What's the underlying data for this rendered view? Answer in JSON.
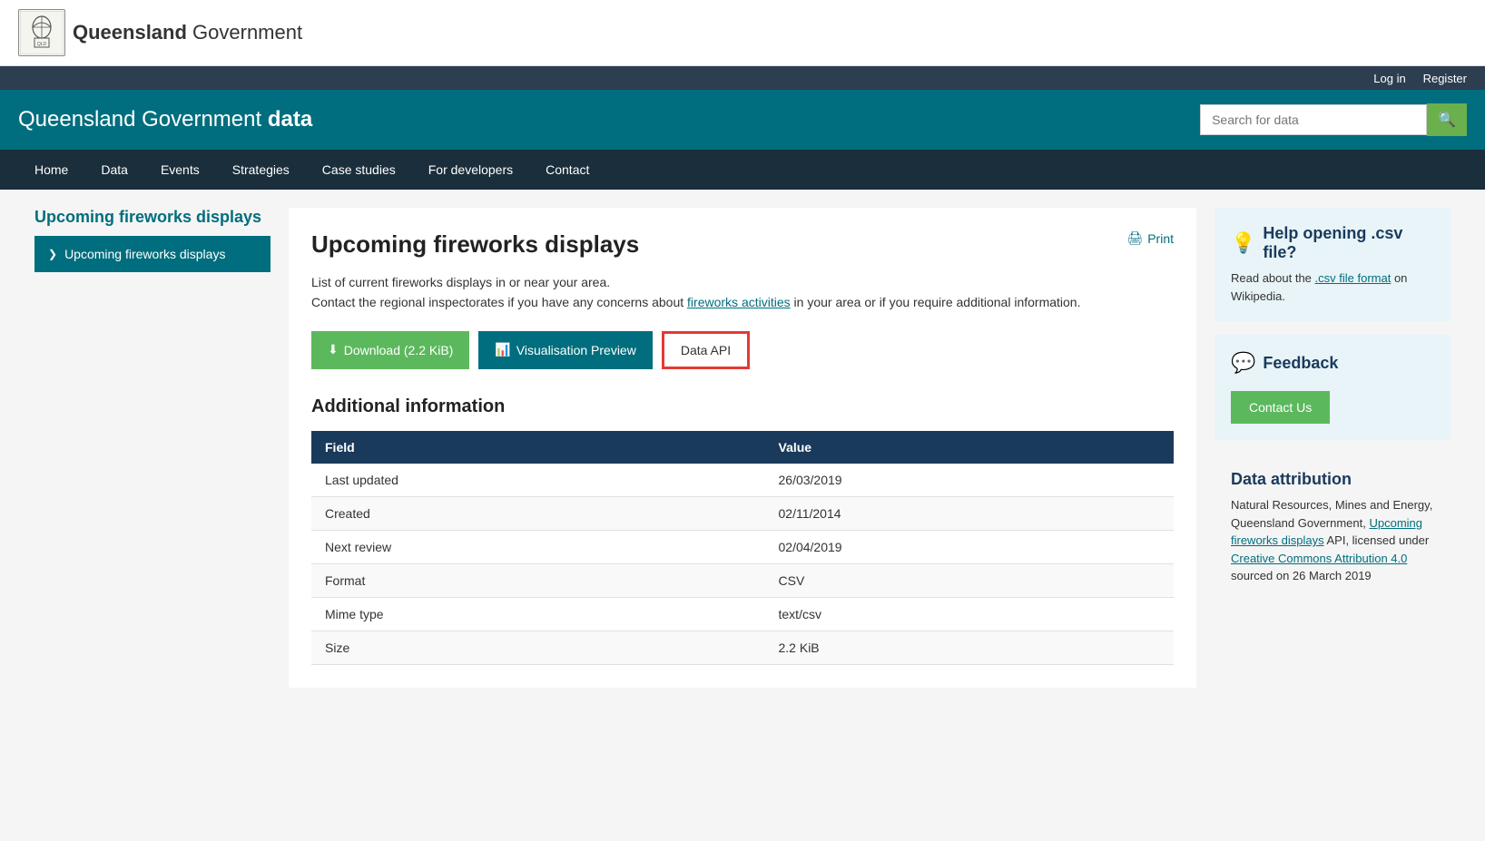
{
  "header": {
    "logo_text_bold": "Queensland",
    "logo_text_normal": " Government",
    "site_title_normal": "Queensland Government ",
    "site_title_bold": "data",
    "search_placeholder": "Search for data"
  },
  "auth": {
    "login": "Log in",
    "register": "Register"
  },
  "nav": {
    "items": [
      {
        "label": "Home"
      },
      {
        "label": "Data"
      },
      {
        "label": "Events"
      },
      {
        "label": "Strategies"
      },
      {
        "label": "Case studies"
      },
      {
        "label": "For developers"
      },
      {
        "label": "Contact"
      }
    ]
  },
  "sidebar": {
    "title": "Upcoming fireworks displays",
    "item_label": "Upcoming fireworks displays"
  },
  "main": {
    "page_title": "Upcoming fireworks displays",
    "print_label": "Print",
    "description_line1": "List of current fireworks displays in or near your area.",
    "description_line2_pre": "Contact the regional inspectorates if you have any concerns about ",
    "description_link": "fireworks activities",
    "description_line2_post": " in your area or if you require additional information.",
    "btn_download": "Download (2.2 KiB)",
    "btn_visualise": "Visualisation Preview",
    "btn_api": "Data API",
    "additional_info_title": "Additional information",
    "table": {
      "headers": [
        "Field",
        "Value"
      ],
      "rows": [
        {
          "field": "Last updated",
          "value": "26/03/2019"
        },
        {
          "field": "Created",
          "value": "02/11/2014"
        },
        {
          "field": "Next review",
          "value": "02/04/2019"
        },
        {
          "field": "Format",
          "value": "CSV"
        },
        {
          "field": "Mime type",
          "value": "text/csv"
        },
        {
          "field": "Size",
          "value": "2.2 KiB"
        }
      ]
    }
  },
  "right_sidebar": {
    "help_title": "Help opening .csv file?",
    "help_text_pre": "Read about the ",
    "help_link": ".csv file format",
    "help_text_post": " on Wikipedia.",
    "feedback_title": "Feedback",
    "contact_btn": "Contact Us",
    "attrib_title": "Data attribution",
    "attrib_text_pre": "Natural Resources, Mines and Energy, Queensland Government, ",
    "attrib_link": "Upcoming fireworks displays",
    "attrib_text_mid": " API, licensed under ",
    "attrib_link2": "Creative Commons Attribution 4.0",
    "attrib_text_post": " sourced on 26 March 2019"
  }
}
